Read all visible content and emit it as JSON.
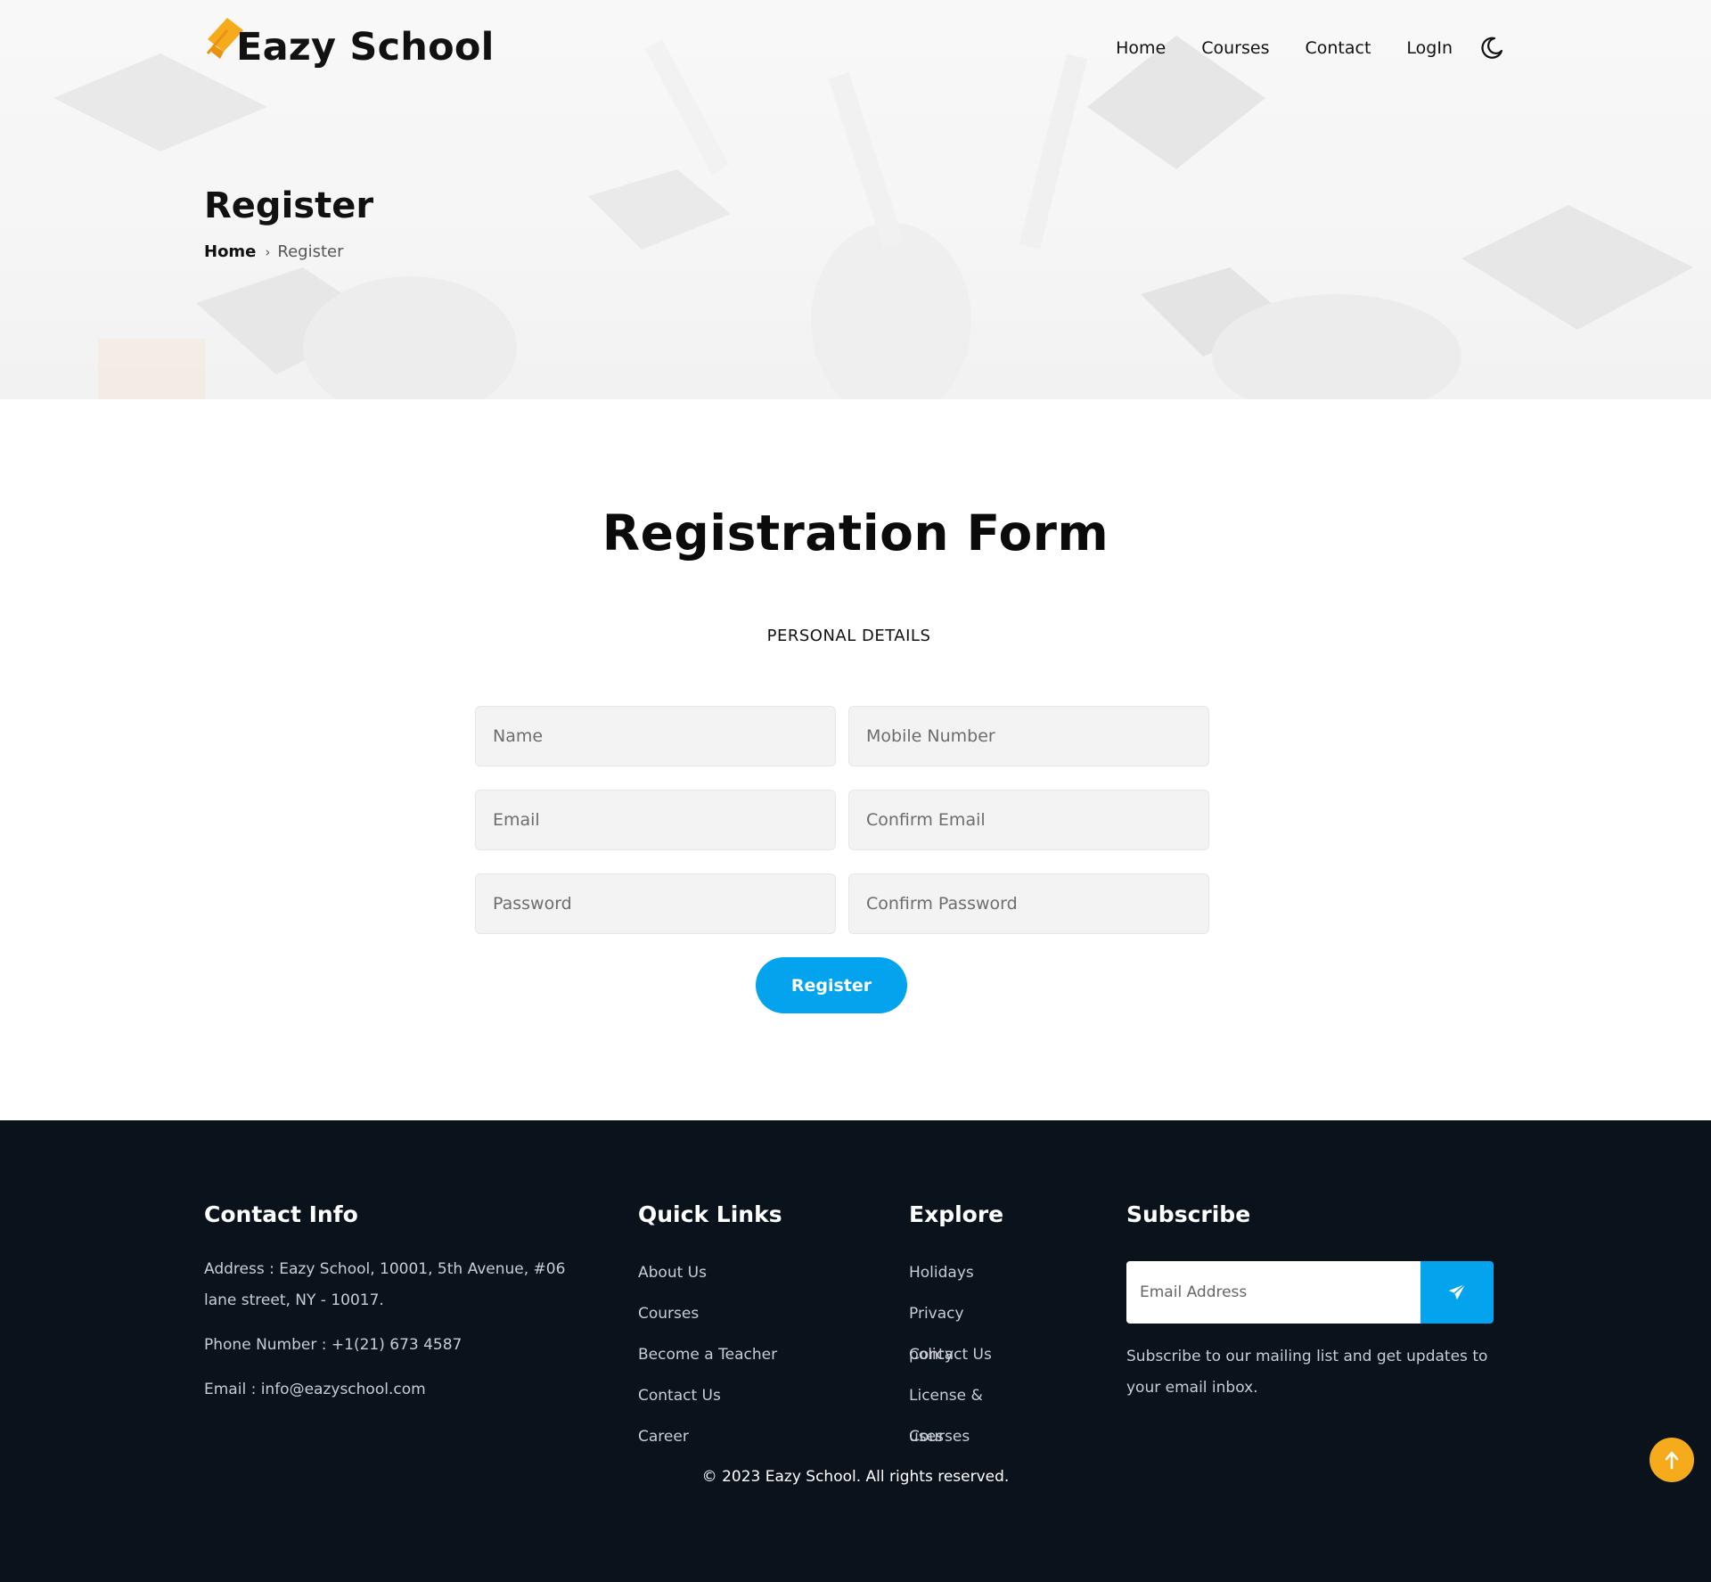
{
  "brand": {
    "name": "Eazy School",
    "icon": "graduation-cap-icon",
    "accent": "#f6ab1c"
  },
  "nav": {
    "items": [
      {
        "label": "Home"
      },
      {
        "label": "Courses"
      },
      {
        "label": "Contact"
      },
      {
        "label": "LogIn"
      }
    ],
    "theme_toggle_icon": "moon-icon"
  },
  "hero": {
    "title": "Register",
    "breadcrumb": {
      "home": "Home",
      "separator": "›",
      "current": "Register"
    }
  },
  "form": {
    "title": "Registration Form",
    "section": "PERSONAL DETAILS",
    "fields": {
      "name": {
        "placeholder": "Name"
      },
      "mobile": {
        "placeholder": "Mobile Number"
      },
      "email": {
        "placeholder": "Email"
      },
      "confirm_email": {
        "placeholder": "Confirm Email"
      },
      "password": {
        "placeholder": "Password"
      },
      "confirm_password": {
        "placeholder": "Confirm Password"
      }
    },
    "submit_label": "Register",
    "button_color": "#03a3ee"
  },
  "footer": {
    "background": "#0a121c",
    "contact": {
      "title": "Contact Info",
      "address": "Address : Eazy School, 10001, 5th Avenue, #06 lane street, NY - 10017.",
      "phone": "Phone Number : +1(21) 673 4587",
      "email": "Email : info@eazyschool.com"
    },
    "quick_links": {
      "title": "Quick Links",
      "items": [
        "About Us",
        "Courses",
        "Become a Teacher",
        "Contact Us",
        "Career"
      ]
    },
    "explore": {
      "title": "Explore",
      "items": [
        "Holidays",
        "Privacy policy",
        "Contact Us",
        "License & uses",
        "Courses"
      ]
    },
    "subscribe": {
      "title": "Subscribe",
      "placeholder": "Email Address",
      "send_icon": "paper-plane-icon",
      "text": "Subscribe to our mailing list and get updates to your email inbox."
    },
    "copyright": "© 2023 Eazy School. All rights reserved.",
    "back_to_top_icon": "arrow-up-icon"
  }
}
